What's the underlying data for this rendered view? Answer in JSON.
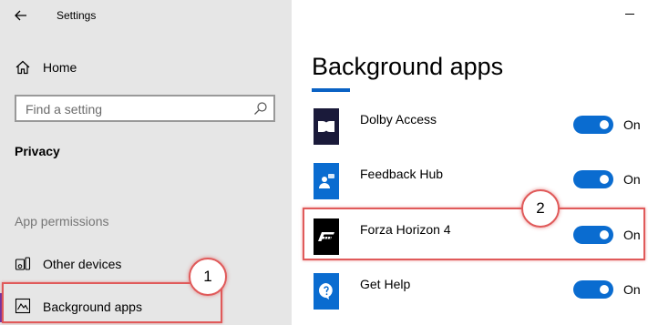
{
  "window": {
    "title": "Settings",
    "back_icon": "arrow-left-icon",
    "minimize_icon": "minimize-icon"
  },
  "sidebar": {
    "home": {
      "label": "Home",
      "icon": "home-icon"
    },
    "search": {
      "placeholder": "Find a setting",
      "value": "",
      "icon": "search-icon"
    },
    "section_heading": "Privacy",
    "group_label": "App permissions",
    "items": [
      {
        "label": "Other devices",
        "icon": "devices-icon",
        "active": false
      },
      {
        "label": "Background apps",
        "icon": "background-apps-icon",
        "active": true
      }
    ],
    "active_color": "#6b2fa6"
  },
  "main": {
    "title": "Background apps",
    "accent_color": "#0a62c4",
    "apps": [
      {
        "name": "Dolby Access",
        "toggle_on": true,
        "state_label": "On",
        "icon": "dolby-access-icon",
        "icon_bg": "#1a1a3a"
      },
      {
        "name": "Feedback Hub",
        "toggle_on": true,
        "state_label": "On",
        "icon": "feedback-hub-icon",
        "icon_bg": "#0a6cd0"
      },
      {
        "name": "Forza Horizon 4",
        "toggle_on": true,
        "state_label": "On",
        "icon": "forza-horizon-icon",
        "icon_bg": "#000000"
      },
      {
        "name": "Get Help",
        "toggle_on": true,
        "state_label": "On",
        "icon": "get-help-icon",
        "icon_bg": "#0a6cd0"
      }
    ],
    "toggle_color": "#0a6cd0"
  },
  "annotations": {
    "callout_1": "1",
    "callout_2": "2",
    "highlight_color": "#e05a5a"
  }
}
